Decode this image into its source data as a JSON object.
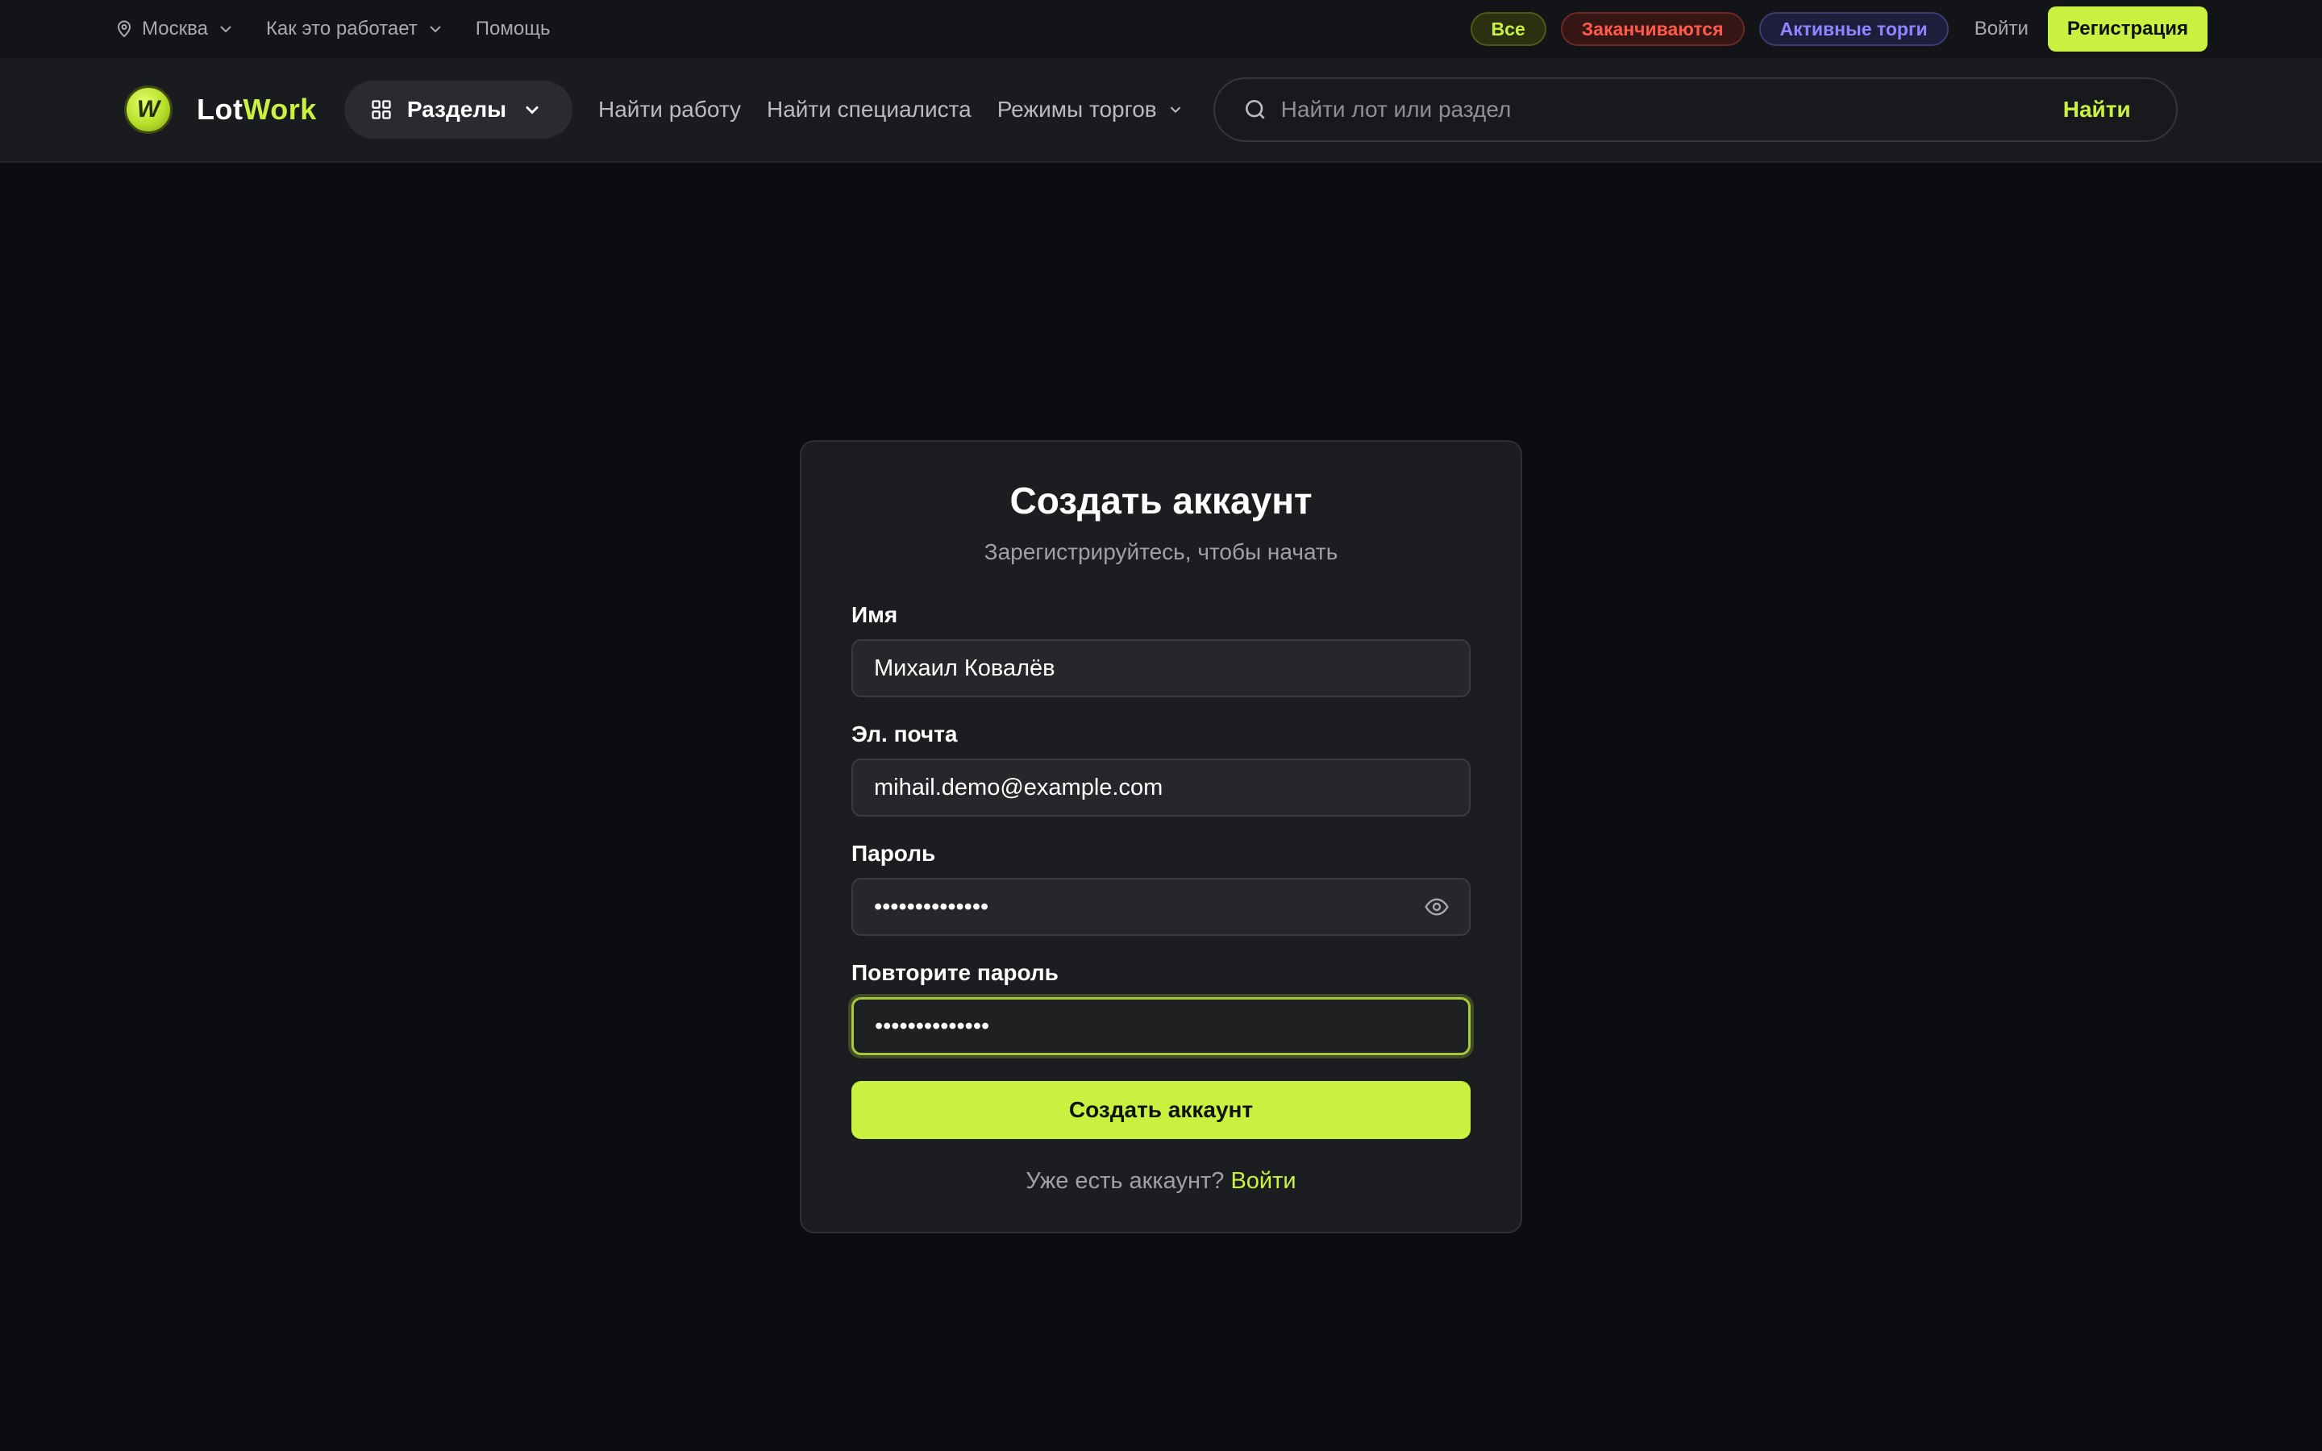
{
  "topbar": {
    "city": "Москва",
    "how_it_works": "Как это работает",
    "help": "Помощь",
    "chips": {
      "all": "Все",
      "ending": "Заканчиваются",
      "active": "Активные торги"
    },
    "login": "Войти",
    "register": "Регистрация"
  },
  "header": {
    "logo_part1": "Lot",
    "logo_part2": "Work",
    "sections": "Разделы",
    "nav": {
      "find_work": "Найти работу",
      "find_specialist": "Найти специалиста",
      "trade_modes": "Режимы торгов"
    },
    "search": {
      "placeholder": "Найти лот или раздел",
      "button": "Найти"
    }
  },
  "form": {
    "title": "Создать аккаунт",
    "subtitle": "Зарегистрируйтесь, чтобы начать",
    "name_label": "Имя",
    "name_value": "Михаил Ковалёв",
    "email_label": "Эл. почта",
    "email_value": "mihail.demo@example.com",
    "password_label": "Пароль",
    "password_value": "••••••••••••••",
    "confirm_label": "Повторите пароль",
    "confirm_value": "••••••••••••••",
    "submit": "Создать аккаунт",
    "have_account": "Уже есть аккаунт?",
    "signin": "Войти"
  },
  "icons": {
    "location": "location-pin-icon",
    "chevron": "chevron-down-icon",
    "grid": "grid-icon",
    "search": "search-icon",
    "eye": "eye-icon"
  },
  "colors": {
    "accent": "#c8f23f",
    "background": "#0c0d11",
    "card": "#1c1d21",
    "danger": "#ff5a4a",
    "violet": "#8e86ff"
  }
}
